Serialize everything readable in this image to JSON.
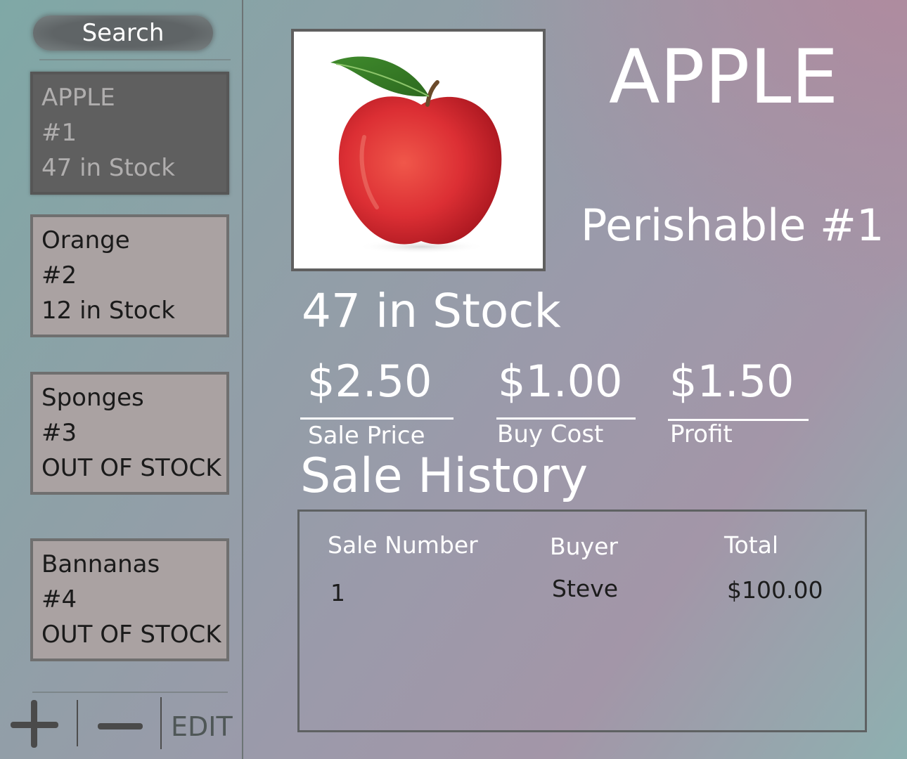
{
  "sidebar": {
    "search_label": "Search",
    "items": [
      {
        "name": "APPLE",
        "number": "#1",
        "stock": "47 in Stock",
        "selected": true
      },
      {
        "name": "Orange",
        "number": "#2",
        "stock": "12 in Stock",
        "selected": false
      },
      {
        "name": "Sponges",
        "number": "#3",
        "stock": "OUT OF STOCK",
        "selected": false
      },
      {
        "name": "Bannanas",
        "number": "#4",
        "stock": "OUT OF STOCK",
        "selected": false
      }
    ],
    "toolbar": {
      "add_icon": "plus-icon",
      "remove_icon": "minus-icon",
      "edit_label": "EDIT"
    }
  },
  "detail": {
    "image_icon": "apple-image",
    "title": "APPLE",
    "category": "Perishable #1",
    "stock": "47 in Stock",
    "sale_price": {
      "value": "$2.50",
      "label": "Sale Price"
    },
    "buy_cost": {
      "value": "$1.00",
      "label": "Buy Cost"
    },
    "profit": {
      "value": "$1.50",
      "label": "Profit"
    }
  },
  "history": {
    "title": "Sale History",
    "columns": [
      "Sale Number",
      "Buyer",
      "Total"
    ],
    "rows": [
      [
        "1",
        "Steve",
        "$100.00"
      ]
    ]
  },
  "colors": {
    "selected_item_bg": "#5f5f5f",
    "item_bg": "#aaa2a2",
    "text_light": "#ffffff"
  }
}
